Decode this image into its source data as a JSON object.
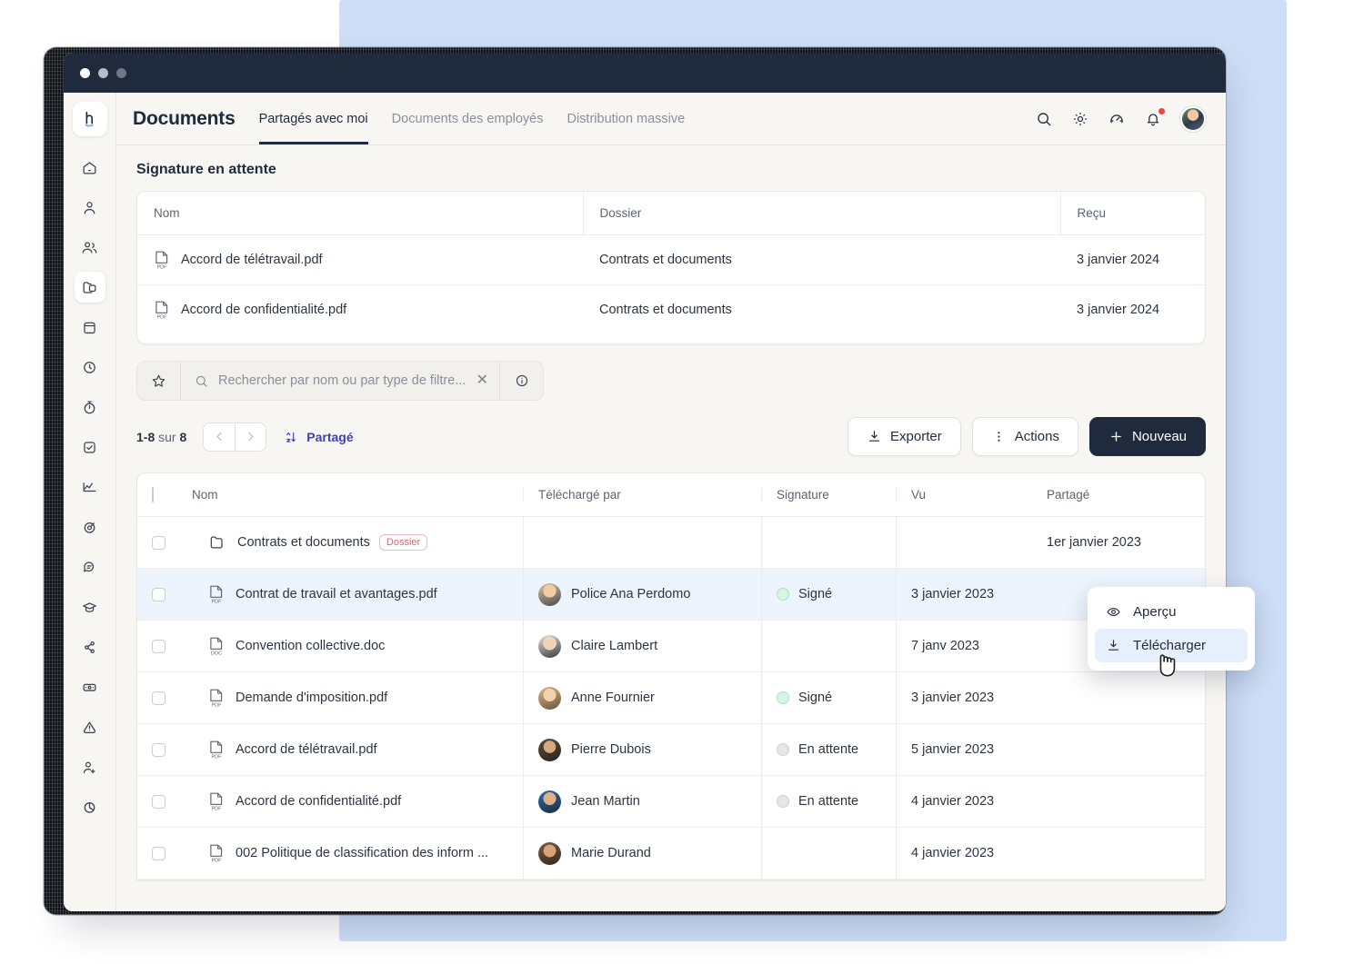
{
  "window": {
    "traffic_lights": [
      "close",
      "minimize",
      "maximize"
    ]
  },
  "header": {
    "app_title": "Documents",
    "tabs": [
      {
        "label": "Partagés avec moi",
        "active": true
      },
      {
        "label": "Documents des employés",
        "active": false
      },
      {
        "label": "Distribution massive",
        "active": false
      }
    ],
    "icons": [
      {
        "name": "search-icon"
      },
      {
        "name": "gear-icon"
      },
      {
        "name": "speedometer-icon"
      },
      {
        "name": "bell-icon",
        "has_badge": true
      },
      {
        "name": "avatar"
      }
    ]
  },
  "sidebar": {
    "logo": "h",
    "items": [
      {
        "name": "home-icon",
        "active": false
      },
      {
        "name": "user-icon",
        "active": false
      },
      {
        "name": "people-icon",
        "active": false
      },
      {
        "name": "folder-documents-icon",
        "active": true
      },
      {
        "name": "calendar-icon",
        "active": false
      },
      {
        "name": "clock-icon",
        "active": false
      },
      {
        "name": "timer-icon",
        "active": false
      },
      {
        "name": "checkbox-icon",
        "active": false
      },
      {
        "name": "chart-line-icon",
        "active": false
      },
      {
        "name": "target-icon",
        "active": false
      },
      {
        "name": "chat-icon",
        "active": false
      },
      {
        "name": "graduation-cap-icon",
        "active": false
      },
      {
        "name": "workflow-icon",
        "active": false
      },
      {
        "name": "money-icon",
        "active": false
      },
      {
        "name": "alert-icon",
        "active": false
      },
      {
        "name": "user-add-icon",
        "active": false
      },
      {
        "name": "pie-chart-icon",
        "active": false
      }
    ]
  },
  "pending_section": {
    "title": "Signature en attente",
    "columns": [
      "Nom",
      "Dossier",
      "Reçu"
    ],
    "rows": [
      {
        "icon": "pdf-file-icon",
        "name": "Accord de télétravail.pdf",
        "folder": "Contrats et documents",
        "received": "3 janvier 2024"
      },
      {
        "icon": "pdf-file-icon",
        "name": "Accord de confidentialité.pdf",
        "folder": "Contrats et documents",
        "received": "3 janvier 2024"
      }
    ]
  },
  "filter_bar": {
    "star_icon": "star-icon",
    "search_icon": "search-icon",
    "placeholder": "Rechercher par nom ou par type de filtre...",
    "clear_icon": "close-icon",
    "info_icon": "info-icon"
  },
  "toolbar": {
    "range": "1-8",
    "of_label": "sur",
    "total": "8",
    "prev_icon": "chevron-left-icon",
    "next_icon": "chevron-right-icon",
    "sort_icon": "sort-az-icon",
    "sort_label": "Partagé",
    "export_label": "Exporter",
    "export_icon": "download-icon",
    "actions_label": "Actions",
    "actions_icon": "dots-vertical-icon",
    "new_label": "Nouveau",
    "new_icon": "plus-icon"
  },
  "documents_table": {
    "columns": [
      "",
      "Nom",
      "Téléchargé par",
      "Signature",
      "Vu",
      "Partagé"
    ],
    "rows": [
      {
        "icon": "folder-icon",
        "name": "Contrats et documents",
        "badge": "Dossier",
        "uploaded_by": "",
        "avatar_color": "",
        "signature": "",
        "viewed": "",
        "shared": "1er janvier 2023",
        "selected": false
      },
      {
        "icon": "pdf-file-icon",
        "name": "Contrat de travail et avantages.pdf",
        "badge": "",
        "uploaded_by": "Police Ana Perdomo",
        "avatar_color": "#e8b98e",
        "signature": "Signé",
        "signature_state": "signed",
        "viewed": "3 janvier 2023",
        "shared": "",
        "selected": true
      },
      {
        "icon": "doc-file-icon",
        "name": "Convention collective.doc",
        "badge": "",
        "uploaded_by": "Claire Lambert",
        "avatar_color": "#d8bda5",
        "signature": "",
        "signature_state": "",
        "viewed": "7 janv 2023",
        "shared": "",
        "selected": false
      },
      {
        "icon": "pdf-file-icon",
        "name": "Demande d'imposition.pdf",
        "badge": "",
        "uploaded_by": "Anne Fournier",
        "avatar_color": "#e3c49c",
        "signature": "Signé",
        "signature_state": "signed",
        "viewed": "3 janvier 2023",
        "shared": "",
        "selected": false
      },
      {
        "icon": "pdf-file-icon",
        "name": "Accord de télétravail.pdf",
        "badge": "",
        "uploaded_by": "Pierre Dubois",
        "avatar_color": "#6b5a4a",
        "signature": "En attente",
        "signature_state": "pending",
        "viewed": "5 janvier 2023",
        "shared": "",
        "selected": false
      },
      {
        "icon": "pdf-file-icon",
        "name": "Accord de confidentialité.pdf",
        "badge": "",
        "uploaded_by": "Jean Martin",
        "avatar_color": "#2f5f8f",
        "signature": "En attente",
        "signature_state": "pending",
        "viewed": "4 janvier 2023",
        "shared": "",
        "selected": false
      },
      {
        "icon": "pdf-file-icon",
        "name": "002 Politique de classification des inform ...",
        "badge": "",
        "uploaded_by": "Marie Durand",
        "avatar_color": "#8c6b52",
        "signature": "",
        "signature_state": "",
        "viewed": "4 janvier 2023",
        "shared": "",
        "selected": false
      }
    ]
  },
  "context_menu": {
    "items": [
      {
        "icon": "eye-icon",
        "label": "Aperçu",
        "hover": false
      },
      {
        "icon": "download-icon",
        "label": "Télécharger",
        "hover": true
      }
    ]
  },
  "colors": {
    "accent_dark": "#1f2a3d",
    "accent_blue": "#3b42b5",
    "row_selected": "#eef4fd",
    "signed_green": "#d6f5e3",
    "pending_grey": "#e6e6e6",
    "badge_red": "#e06070",
    "backdrop_blue": "#cedef7",
    "surface": "#f7f6f3"
  }
}
